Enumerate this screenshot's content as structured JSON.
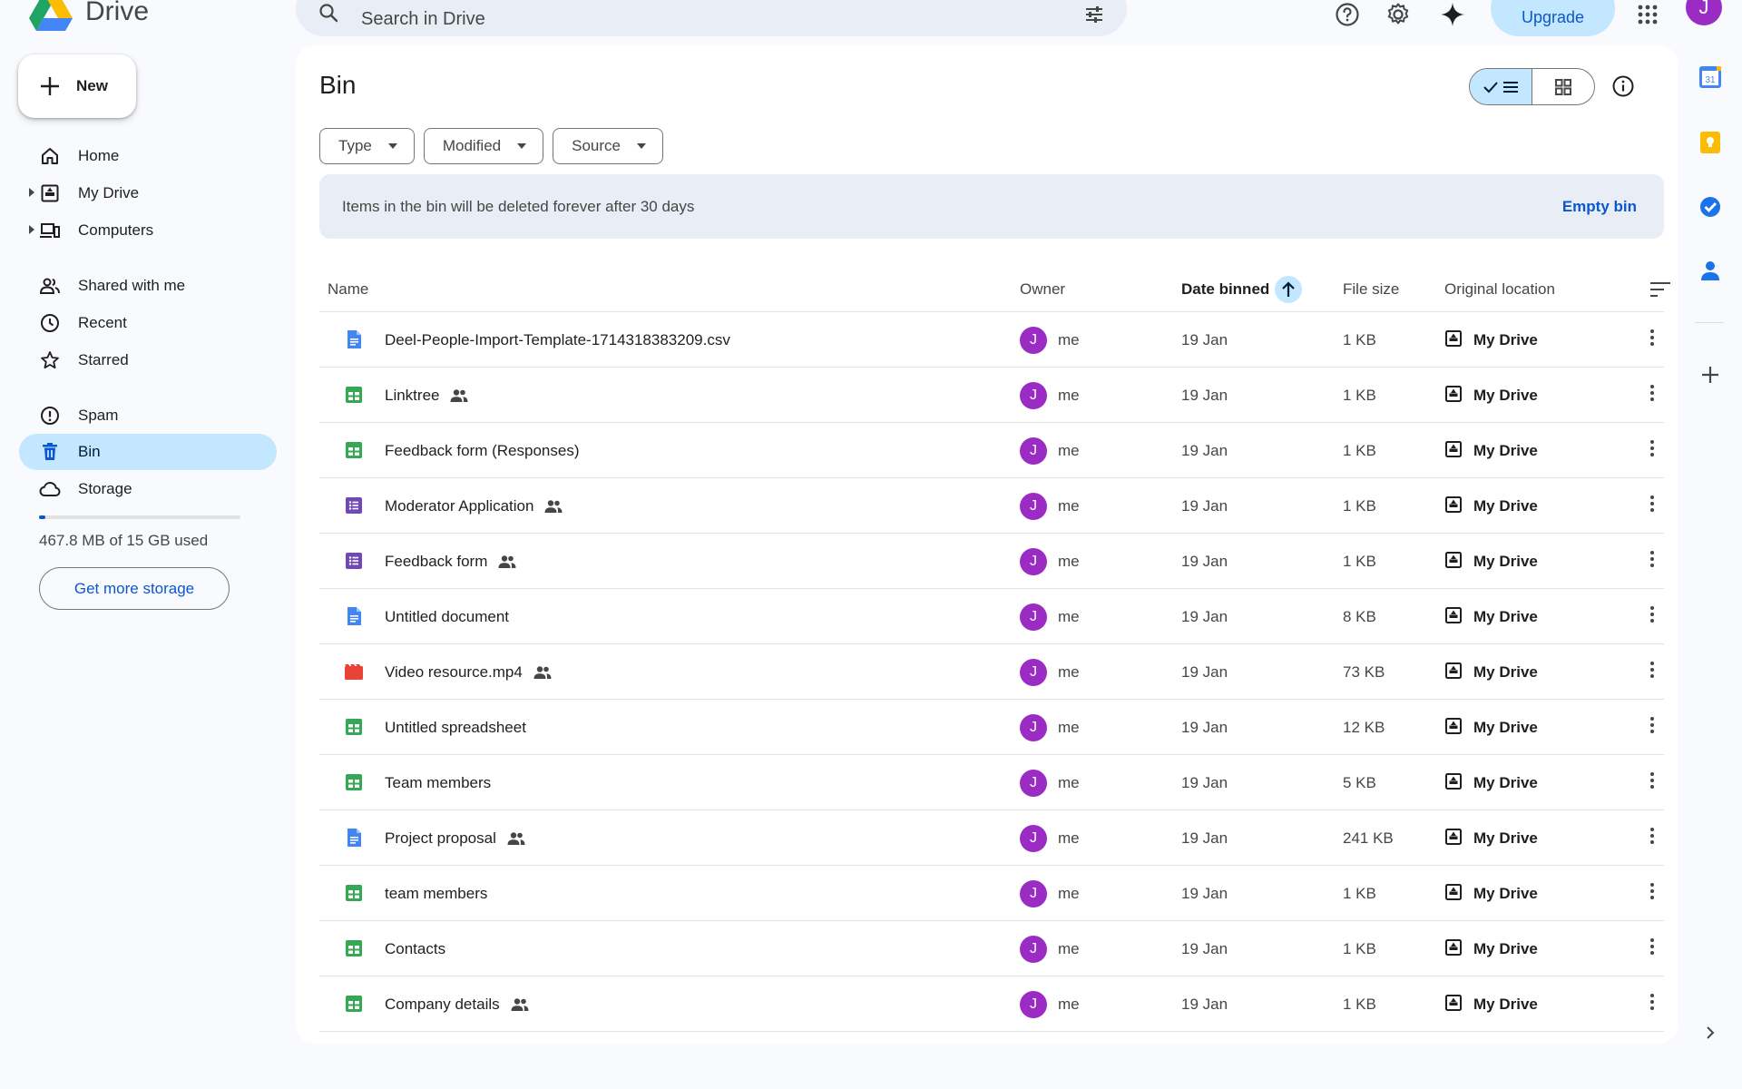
{
  "app": {
    "name": "Drive"
  },
  "search": {
    "placeholder": "Search in Drive"
  },
  "header": {
    "upgrade_label": "Upgrade",
    "avatar_initial": "J"
  },
  "sidebar": {
    "new_label": "New",
    "items": [
      {
        "label": "Home",
        "icon": "home-icon"
      },
      {
        "label": "My Drive",
        "icon": "my-drive-icon"
      },
      {
        "label": "Computers",
        "icon": "computers-icon"
      },
      {
        "label": "Shared with me",
        "icon": "shared-icon"
      },
      {
        "label": "Recent",
        "icon": "recent-icon"
      },
      {
        "label": "Starred",
        "icon": "star-icon"
      },
      {
        "label": "Spam",
        "icon": "spam-icon"
      },
      {
        "label": "Bin",
        "icon": "bin-icon",
        "active": true
      },
      {
        "label": "Storage",
        "icon": "cloud-icon"
      }
    ],
    "storage_text": "467.8 MB of 15 GB used",
    "storage_fraction": 0.031,
    "more_storage_label": "Get more storage"
  },
  "main": {
    "title": "Bin",
    "filters": [
      {
        "label": "Type"
      },
      {
        "label": "Modified"
      },
      {
        "label": "Source"
      }
    ],
    "banner": {
      "message": "Items in the bin will be deleted forever after 30 days",
      "action": "Empty bin"
    },
    "columns": {
      "name": "Name",
      "owner": "Owner",
      "date": "Date binned",
      "size": "File size",
      "location": "Original location"
    },
    "rows": [
      {
        "name": "Deel-People-Import-Template-1714318383209.csv",
        "type": "doc",
        "shared": false,
        "owner": "me",
        "date": "19 Jan",
        "size": "1 KB",
        "location": "My Drive"
      },
      {
        "name": "Linktree",
        "type": "sheet",
        "shared": true,
        "owner": "me",
        "date": "19 Jan",
        "size": "1 KB",
        "location": "My Drive"
      },
      {
        "name": "Feedback form (Responses)",
        "type": "sheet",
        "shared": false,
        "owner": "me",
        "date": "19 Jan",
        "size": "1 KB",
        "location": "My Drive"
      },
      {
        "name": "Moderator Application",
        "type": "form",
        "shared": true,
        "owner": "me",
        "date": "19 Jan",
        "size": "1 KB",
        "location": "My Drive"
      },
      {
        "name": "Feedback form",
        "type": "form",
        "shared": true,
        "owner": "me",
        "date": "19 Jan",
        "size": "1 KB",
        "location": "My Drive"
      },
      {
        "name": "Untitled document",
        "type": "doc",
        "shared": false,
        "owner": "me",
        "date": "19 Jan",
        "size": "8 KB",
        "location": "My Drive"
      },
      {
        "name": "Video resource.mp4",
        "type": "video",
        "shared": true,
        "owner": "me",
        "date": "19 Jan",
        "size": "73 KB",
        "location": "My Drive"
      },
      {
        "name": "Untitled spreadsheet",
        "type": "sheet",
        "shared": false,
        "owner": "me",
        "date": "19 Jan",
        "size": "12 KB",
        "location": "My Drive"
      },
      {
        "name": "Team members",
        "type": "sheet",
        "shared": false,
        "owner": "me",
        "date": "19 Jan",
        "size": "5 KB",
        "location": "My Drive"
      },
      {
        "name": "Project proposal",
        "type": "doc",
        "shared": true,
        "owner": "me",
        "date": "19 Jan",
        "size": "241 KB",
        "location": "My Drive"
      },
      {
        "name": "team members",
        "type": "sheet",
        "shared": false,
        "owner": "me",
        "date": "19 Jan",
        "size": "1 KB",
        "location": "My Drive"
      },
      {
        "name": "Contacts",
        "type": "sheet",
        "shared": false,
        "owner": "me",
        "date": "19 Jan",
        "size": "1 KB",
        "location": "My Drive"
      },
      {
        "name": "Company details",
        "type": "sheet",
        "shared": true,
        "owner": "me",
        "date": "19 Jan",
        "size": "1 KB",
        "location": "My Drive"
      }
    ]
  },
  "rail": {
    "calendar_day": "31"
  },
  "colors": {
    "accent": "#0b57d0",
    "active_bg": "#c2e7ff",
    "avatar": "#9a2cc4",
    "doc": "#4285f4",
    "sheet": "#34a853",
    "form": "#7248b9",
    "video": "#ea4335"
  }
}
